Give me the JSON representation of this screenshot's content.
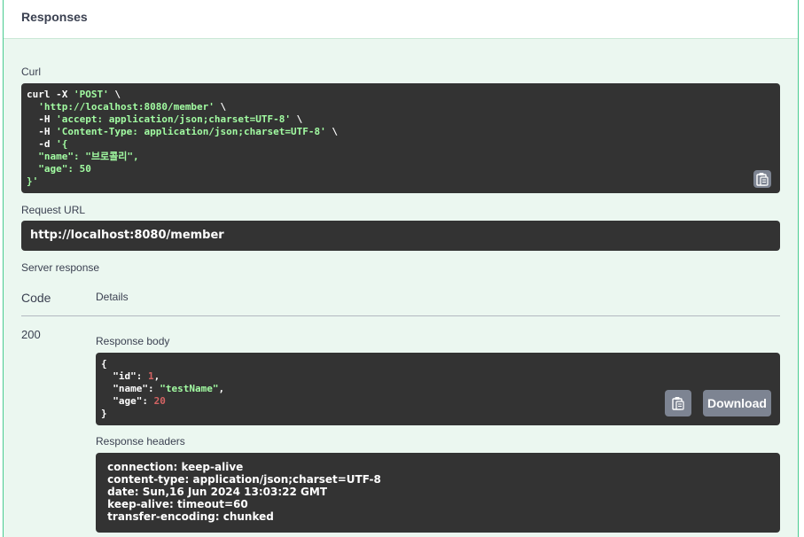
{
  "panel": {
    "title": "Responses"
  },
  "curl": {
    "label": "Curl",
    "lines": [
      {
        "w": "curl -X ",
        "s": "'POST'",
        "t": " \\"
      },
      {
        "w": "  ",
        "s": "'http://localhost:8080/member'",
        "t": " \\"
      },
      {
        "w": "  -H ",
        "s": "'accept: application/json;charset=UTF-8'",
        "t": " \\"
      },
      {
        "w": "  -H ",
        "s": "'Content-Type: application/json;charset=UTF-8'",
        "t": " \\"
      },
      {
        "w": "  -d ",
        "s": "'{",
        "t": ""
      },
      {
        "w": "",
        "s": "  \"name\": \"브로콜리\",",
        "t": ""
      },
      {
        "w": "",
        "s": "  \"age\": 50",
        "t": ""
      },
      {
        "w": "",
        "s": "}'",
        "t": ""
      }
    ]
  },
  "request_url": {
    "label": "Request URL",
    "value": "http://localhost:8080/member"
  },
  "server_response": {
    "label": "Server response",
    "code_header": "Code",
    "details_header": "Details",
    "status_code": "200",
    "body_label": "Response body",
    "body": {
      "open": "{",
      "id_key": "  \"id\"",
      "id_val": "1",
      "name_key": "  \"name\"",
      "name_val": "\"testName\"",
      "age_key": "  \"age\"",
      "age_val": "20",
      "close": "}"
    },
    "download_label": "Download",
    "headers_label": "Response headers",
    "headers": [
      " connection: keep-alive ",
      " content-type: application/json;charset=UTF-8 ",
      " date: Sun,16 Jun 2024 13:03:22 GMT ",
      " keep-alive: timeout=60 ",
      " transfer-encoding: chunked "
    ]
  },
  "colors": {
    "panel_bg": "#ebf7f0",
    "accent": "#49cc90",
    "code_bg": "#333333",
    "string": "#a2fca2",
    "number": "#d36363",
    "button": "#7d8492"
  }
}
